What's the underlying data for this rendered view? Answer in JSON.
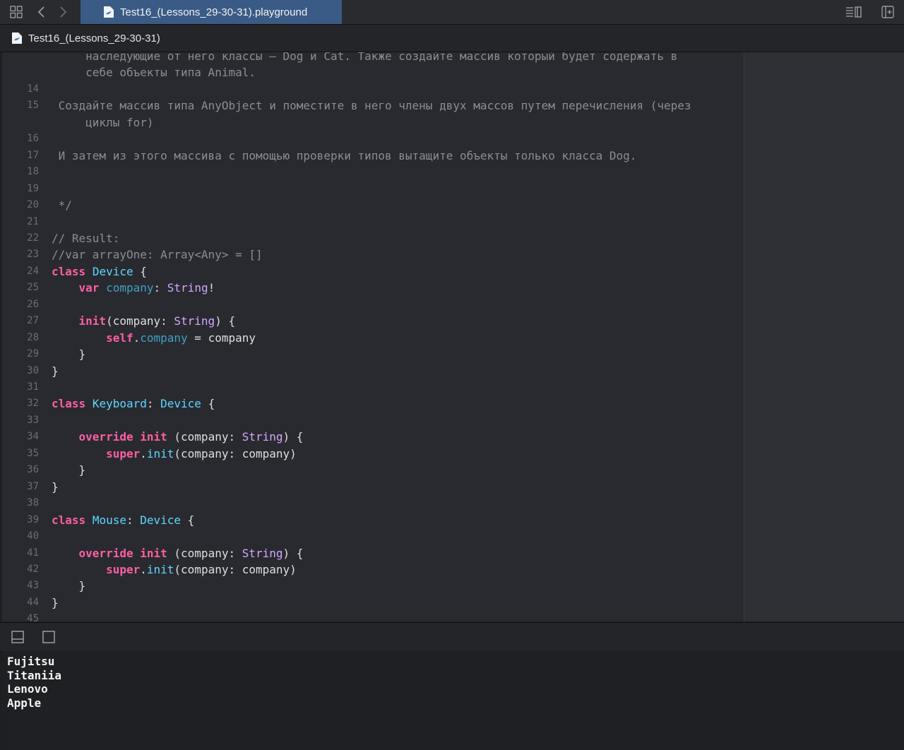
{
  "window": {
    "tab_title": "Test16_(Lessons_29-30-31).playground",
    "jumpbar_title": "Test16_(Lessons_29-30-31)"
  },
  "toolbar": {
    "icons": [
      "grid-icon",
      "back-icon",
      "forward-icon",
      "editor-options-icon",
      "add-editor-icon"
    ]
  },
  "editor": {
    "lines": [
      {
        "n": "",
        "tokens": [
          [
            "c",
            "     наследующие от него классы — Dog и Cat. Также создайте массив который будет содержать в"
          ]
        ]
      },
      {
        "n": "",
        "tokens": [
          [
            "c",
            "     себе объекты типа Animal."
          ]
        ]
      },
      {
        "n": "14",
        "tokens": []
      },
      {
        "n": "15",
        "tokens": [
          [
            "c",
            " Создайте массив типа AnyObject и поместите в него члены двух массов путем перечисления (через"
          ]
        ]
      },
      {
        "n": "",
        "tokens": [
          [
            "c",
            "     циклы for)"
          ]
        ]
      },
      {
        "n": "16",
        "tokens": []
      },
      {
        "n": "17",
        "tokens": [
          [
            "c",
            " И затем из этого массива с помощью проверки типов вытащите объекты только класса Dog."
          ]
        ]
      },
      {
        "n": "18",
        "tokens": []
      },
      {
        "n": "19",
        "tokens": []
      },
      {
        "n": "20",
        "tokens": [
          [
            "c",
            " */"
          ]
        ]
      },
      {
        "n": "21",
        "tokens": []
      },
      {
        "n": "22",
        "tokens": [
          [
            "c",
            "// Result:"
          ]
        ]
      },
      {
        "n": "23",
        "tokens": [
          [
            "c",
            "//var arrayOne: Array<Any> = []"
          ]
        ]
      },
      {
        "n": "24",
        "tokens": [
          [
            "k",
            "class"
          ],
          [
            "pl",
            " "
          ],
          [
            "t",
            "Device"
          ],
          [
            "pl",
            " {"
          ]
        ]
      },
      {
        "n": "25",
        "tokens": [
          [
            "pl",
            "    "
          ],
          [
            "k",
            "var"
          ],
          [
            "pl",
            " "
          ],
          [
            "f",
            "company"
          ],
          [
            "pl",
            ": "
          ],
          [
            "p",
            "String"
          ],
          [
            "pl",
            "!"
          ]
        ]
      },
      {
        "n": "26",
        "tokens": []
      },
      {
        "n": "27",
        "tokens": [
          [
            "pl",
            "    "
          ],
          [
            "k",
            "init"
          ],
          [
            "pl",
            "(company: "
          ],
          [
            "p",
            "String"
          ],
          [
            "pl",
            ") {"
          ]
        ]
      },
      {
        "n": "28",
        "tokens": [
          [
            "pl",
            "        "
          ],
          [
            "k",
            "self"
          ],
          [
            "pl",
            "."
          ],
          [
            "f",
            "company"
          ],
          [
            "pl",
            " = company"
          ]
        ]
      },
      {
        "n": "29",
        "tokens": [
          [
            "pl",
            "    }"
          ]
        ]
      },
      {
        "n": "30",
        "tokens": [
          [
            "pl",
            "}"
          ]
        ]
      },
      {
        "n": "31",
        "tokens": []
      },
      {
        "n": "32",
        "tokens": [
          [
            "k",
            "class"
          ],
          [
            "pl",
            " "
          ],
          [
            "t",
            "Keyboard"
          ],
          [
            "pl",
            ": "
          ],
          [
            "t",
            "Device"
          ],
          [
            "pl",
            " {"
          ]
        ]
      },
      {
        "n": "33",
        "tokens": []
      },
      {
        "n": "34",
        "tokens": [
          [
            "pl",
            "    "
          ],
          [
            "k",
            "override"
          ],
          [
            "pl",
            " "
          ],
          [
            "k",
            "init"
          ],
          [
            "pl",
            " (company: "
          ],
          [
            "p",
            "String"
          ],
          [
            "pl",
            ") {"
          ]
        ]
      },
      {
        "n": "35",
        "tokens": [
          [
            "pl",
            "        "
          ],
          [
            "k",
            "super"
          ],
          [
            "pl",
            "."
          ],
          [
            "t",
            "init"
          ],
          [
            "pl",
            "(company: company)"
          ]
        ]
      },
      {
        "n": "36",
        "tokens": [
          [
            "pl",
            "    }"
          ]
        ]
      },
      {
        "n": "37",
        "tokens": [
          [
            "pl",
            "}"
          ]
        ]
      },
      {
        "n": "38",
        "tokens": []
      },
      {
        "n": "39",
        "tokens": [
          [
            "k",
            "class"
          ],
          [
            "pl",
            " "
          ],
          [
            "t",
            "Mouse"
          ],
          [
            "pl",
            ": "
          ],
          [
            "t",
            "Device"
          ],
          [
            "pl",
            " {"
          ]
        ]
      },
      {
        "n": "40",
        "tokens": []
      },
      {
        "n": "41",
        "tokens": [
          [
            "pl",
            "    "
          ],
          [
            "k",
            "override"
          ],
          [
            "pl",
            " "
          ],
          [
            "k",
            "init"
          ],
          [
            "pl",
            " (company: "
          ],
          [
            "p",
            "String"
          ],
          [
            "pl",
            ") {"
          ]
        ]
      },
      {
        "n": "42",
        "tokens": [
          [
            "pl",
            "        "
          ],
          [
            "k",
            "super"
          ],
          [
            "pl",
            "."
          ],
          [
            "t",
            "init"
          ],
          [
            "pl",
            "(company: company)"
          ]
        ]
      },
      {
        "n": "43",
        "tokens": [
          [
            "pl",
            "    }"
          ]
        ]
      },
      {
        "n": "44",
        "tokens": [
          [
            "pl",
            "}"
          ]
        ]
      },
      {
        "n": "45",
        "tokens": []
      }
    ]
  },
  "debug": {
    "icons": [
      "hide-debug-area-icon",
      "console-toggle-icon"
    ]
  },
  "console": {
    "lines": [
      "Fujitsu",
      "Titaniia",
      "Lenovo",
      "Apple"
    ]
  },
  "colors": {
    "keyword": "#fc5fa3",
    "type": "#5dd8ff",
    "stdlib_type": "#d0a8ff",
    "property": "#41a1c0",
    "comment": "#8c8d92",
    "tab_active": "#3a5b85"
  }
}
